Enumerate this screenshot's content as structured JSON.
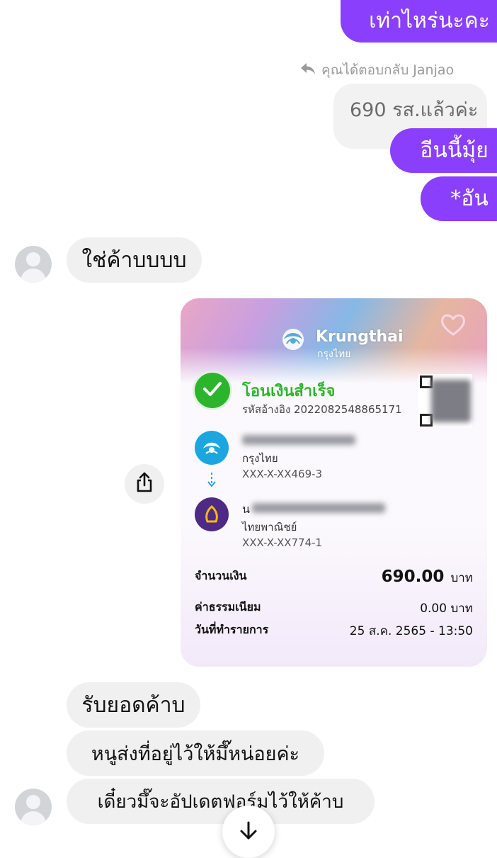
{
  "messages": {
    "out1": "เท่าไหร่นะคะ",
    "reply_note": "คุณได้ตอบกลับ Janjao",
    "quoted": "690 รส.แล้วค่ะ",
    "out2": "อีนนี้มุ้ย",
    "out3": "*อัน",
    "in1": "ใช่ค้าบบบบ",
    "in2": "รับยอดค้าบ",
    "in3": "หนูส่งที่อยู่ไว้ให้มึ๊หน่อยค่ะ",
    "in4": "เดี๋ยวมึ๊จะอัปเดตฟอร์มไว้ให้ค้าบ"
  },
  "receipt": {
    "bank_en": "Krungthai",
    "bank_th": "กรุงไทย",
    "status": "โอนเงินสำเร็จ",
    "ref_label": "รหัสอ้างอิง",
    "ref_no": "2022082548865171",
    "sender_bank": "กรุงไทย",
    "sender_acct": "XXX-X-XX469-3",
    "receiver_initial": "น",
    "receiver_bank": "ไทยพาณิชย์",
    "receiver_acct": "XXX-X-XX774-1",
    "amount_label": "จำนวนเงิน",
    "amount_value": "690.00",
    "amount_unit": "บาท",
    "fee_label": "ค่าธรรมเนียม",
    "fee_value": "0.00 บาท",
    "date_label": "วันที่ทำรายการ",
    "date_value": "25 ส.ค. 2565 - 13:50"
  },
  "colors": {
    "outgoing_bubble": "#8a3ffc",
    "incoming_bubble": "#f0f0f0",
    "status_green": "#2cb52c",
    "krungthai_blue": "#1ba6e0",
    "scb_purple": "#4e2a84"
  },
  "icons": {
    "reply": "reply-arrow-icon",
    "share": "share-icon",
    "scroll_down": "arrow-down-icon",
    "check": "check-icon"
  }
}
